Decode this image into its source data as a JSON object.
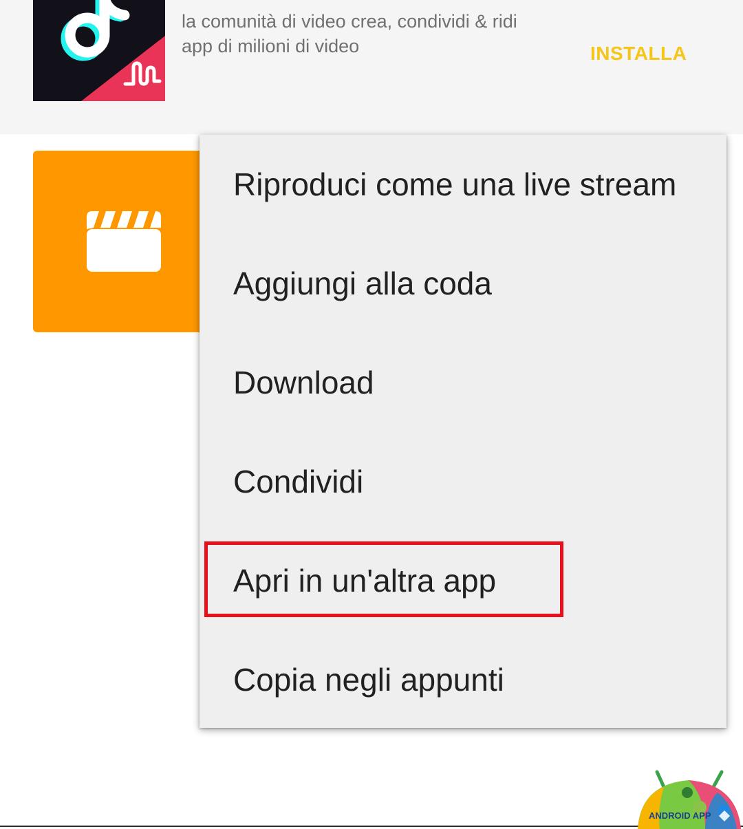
{
  "ad": {
    "description": "la comunità di video crea, condividi & ridi app di milioni di video",
    "install_label": "INSTALLA",
    "icon": "tiktok-app-icon"
  },
  "video": {
    "thumbnail_icon": "clapperboard-icon",
    "thumbnail_color": "#ff9800"
  },
  "menu": {
    "items": [
      {
        "label": "Riproduci come una live stream"
      },
      {
        "label": "Aggiungi alla coda"
      },
      {
        "label": "Download"
      },
      {
        "label": "Condividi"
      },
      {
        "label": "Apri in un'altra app",
        "highlighted": true
      },
      {
        "label": "Copia negli appunti"
      }
    ]
  },
  "highlight": {
    "color": "#e8101a"
  },
  "watermark": {
    "text": "ANDROID APP",
    "icon": "android-logo"
  },
  "colors": {
    "install_accent": "#f5c518",
    "menu_background": "#efefef",
    "banner_background": "#f5f5f5"
  }
}
